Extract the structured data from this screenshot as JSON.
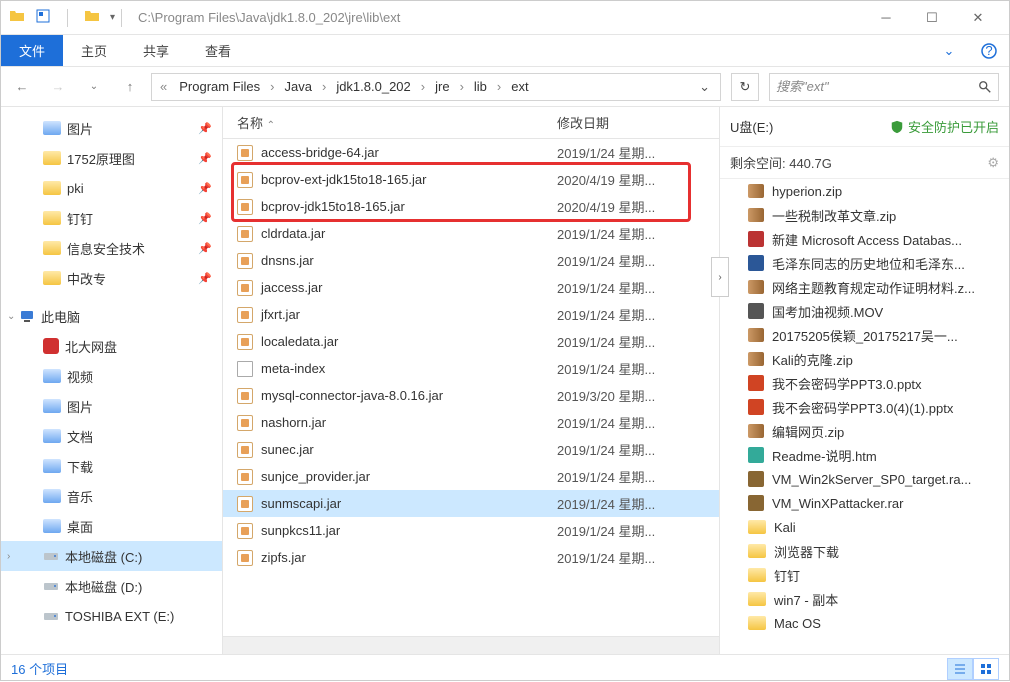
{
  "titlebar": {
    "path": "C:\\Program Files\\Java\\jdk1.8.0_202\\jre\\lib\\ext"
  },
  "ribbon": {
    "file": "文件",
    "tabs": [
      "主页",
      "共享",
      "查看"
    ]
  },
  "breadcrumb": [
    "Program Files",
    "Java",
    "jdk1.8.0_202",
    "jre",
    "lib",
    "ext"
  ],
  "search": {
    "placeholder": "搜索\"ext\""
  },
  "navpane": {
    "quick": [
      {
        "label": "图片",
        "icon": "folder-blue",
        "pin": true
      },
      {
        "label": "1752原理图",
        "icon": "folder",
        "pin": true
      },
      {
        "label": "pki",
        "icon": "folder",
        "pin": true
      },
      {
        "label": "钉钉",
        "icon": "folder",
        "pin": true
      },
      {
        "label": "信息安全技术",
        "icon": "folder",
        "pin": true
      },
      {
        "label": "中改专",
        "icon": "folder",
        "pin": true
      }
    ],
    "thispc_label": "此电脑",
    "baidu_label": "北大网盘",
    "libs": [
      {
        "label": "视频",
        "icon": "folder-blue"
      },
      {
        "label": "图片",
        "icon": "folder-blue"
      },
      {
        "label": "文档",
        "icon": "folder-blue"
      },
      {
        "label": "下载",
        "icon": "folder-blue"
      },
      {
        "label": "音乐",
        "icon": "folder-blue"
      },
      {
        "label": "桌面",
        "icon": "folder-blue"
      }
    ],
    "drives": [
      {
        "label": "本地磁盘 (C:)",
        "selected": true
      },
      {
        "label": "本地磁盘 (D:)"
      },
      {
        "label": "TOSHIBA EXT (E:)"
      }
    ]
  },
  "filelist": {
    "col_name": "名称",
    "col_date": "修改日期",
    "rows": [
      {
        "name": "access-bridge-64.jar",
        "date": "2019/1/24 星期...",
        "icon": "jar"
      },
      {
        "name": "bcprov-ext-jdk15to18-165.jar",
        "date": "2020/4/19 星期...",
        "icon": "jar",
        "hl": true
      },
      {
        "name": "bcprov-jdk15to18-165.jar",
        "date": "2020/4/19 星期...",
        "icon": "jar",
        "hl": true
      },
      {
        "name": "cldrdata.jar",
        "date": "2019/1/24 星期...",
        "icon": "jar"
      },
      {
        "name": "dnsns.jar",
        "date": "2019/1/24 星期...",
        "icon": "jar"
      },
      {
        "name": "jaccess.jar",
        "date": "2019/1/24 星期...",
        "icon": "jar"
      },
      {
        "name": "jfxrt.jar",
        "date": "2019/1/24 星期...",
        "icon": "jar"
      },
      {
        "name": "localedata.jar",
        "date": "2019/1/24 星期...",
        "icon": "jar"
      },
      {
        "name": "meta-index",
        "date": "2019/1/24 星期...",
        "icon": "txt"
      },
      {
        "name": "mysql-connector-java-8.0.16.jar",
        "date": "2019/3/20 星期...",
        "icon": "jar"
      },
      {
        "name": "nashorn.jar",
        "date": "2019/1/24 星期...",
        "icon": "jar"
      },
      {
        "name": "sunec.jar",
        "date": "2019/1/24 星期...",
        "icon": "jar"
      },
      {
        "name": "sunjce_provider.jar",
        "date": "2019/1/24 星期...",
        "icon": "jar"
      },
      {
        "name": "sunmscapi.jar",
        "date": "2019/1/24 星期...",
        "icon": "jar",
        "selected": true
      },
      {
        "name": "sunpkcs11.jar",
        "date": "2019/1/24 星期...",
        "icon": "jar"
      },
      {
        "name": "zipfs.jar",
        "date": "2019/1/24 星期...",
        "icon": "jar"
      }
    ]
  },
  "details": {
    "drive": "U盘(E:)",
    "security": "安全防护已开启",
    "free_space": "剩余空间: 440.7G",
    "items": [
      {
        "label": "hyperion.zip",
        "icon": "zip"
      },
      {
        "label": "一些税制改革文章.zip",
        "icon": "zip"
      },
      {
        "label": "新建 Microsoft Access Databas...",
        "icon": "db"
      },
      {
        "label": "毛泽东同志的历史地位和毛泽东...",
        "icon": "doc"
      },
      {
        "label": "网络主题教育规定动作证明材料.z...",
        "icon": "zip"
      },
      {
        "label": "国考加油视频.MOV",
        "icon": "mov"
      },
      {
        "label": "20175205侯颖_20175217吴一...",
        "icon": "zip"
      },
      {
        "label": "Kali的克隆.zip",
        "icon": "zip"
      },
      {
        "label": "我不会密码学PPT3.0.pptx",
        "icon": "ppt"
      },
      {
        "label": "我不会密码学PPT3.0(4)(1).pptx",
        "icon": "ppt"
      },
      {
        "label": "编辑网页.zip",
        "icon": "zip"
      },
      {
        "label": "Readme-说明.htm",
        "icon": "html"
      },
      {
        "label": "VM_Win2kServer_SP0_target.ra...",
        "icon": "rar"
      },
      {
        "label": "VM_WinXPattacker.rar",
        "icon": "rar"
      },
      {
        "label": "Kali",
        "icon": "folder"
      },
      {
        "label": "浏览器下载",
        "icon": "folder"
      },
      {
        "label": "钉钉",
        "icon": "folder"
      },
      {
        "label": "win7 - 副本",
        "icon": "folder"
      },
      {
        "label": "Mac OS",
        "icon": "folder"
      }
    ]
  },
  "statusbar": {
    "count": "16 个项目"
  }
}
